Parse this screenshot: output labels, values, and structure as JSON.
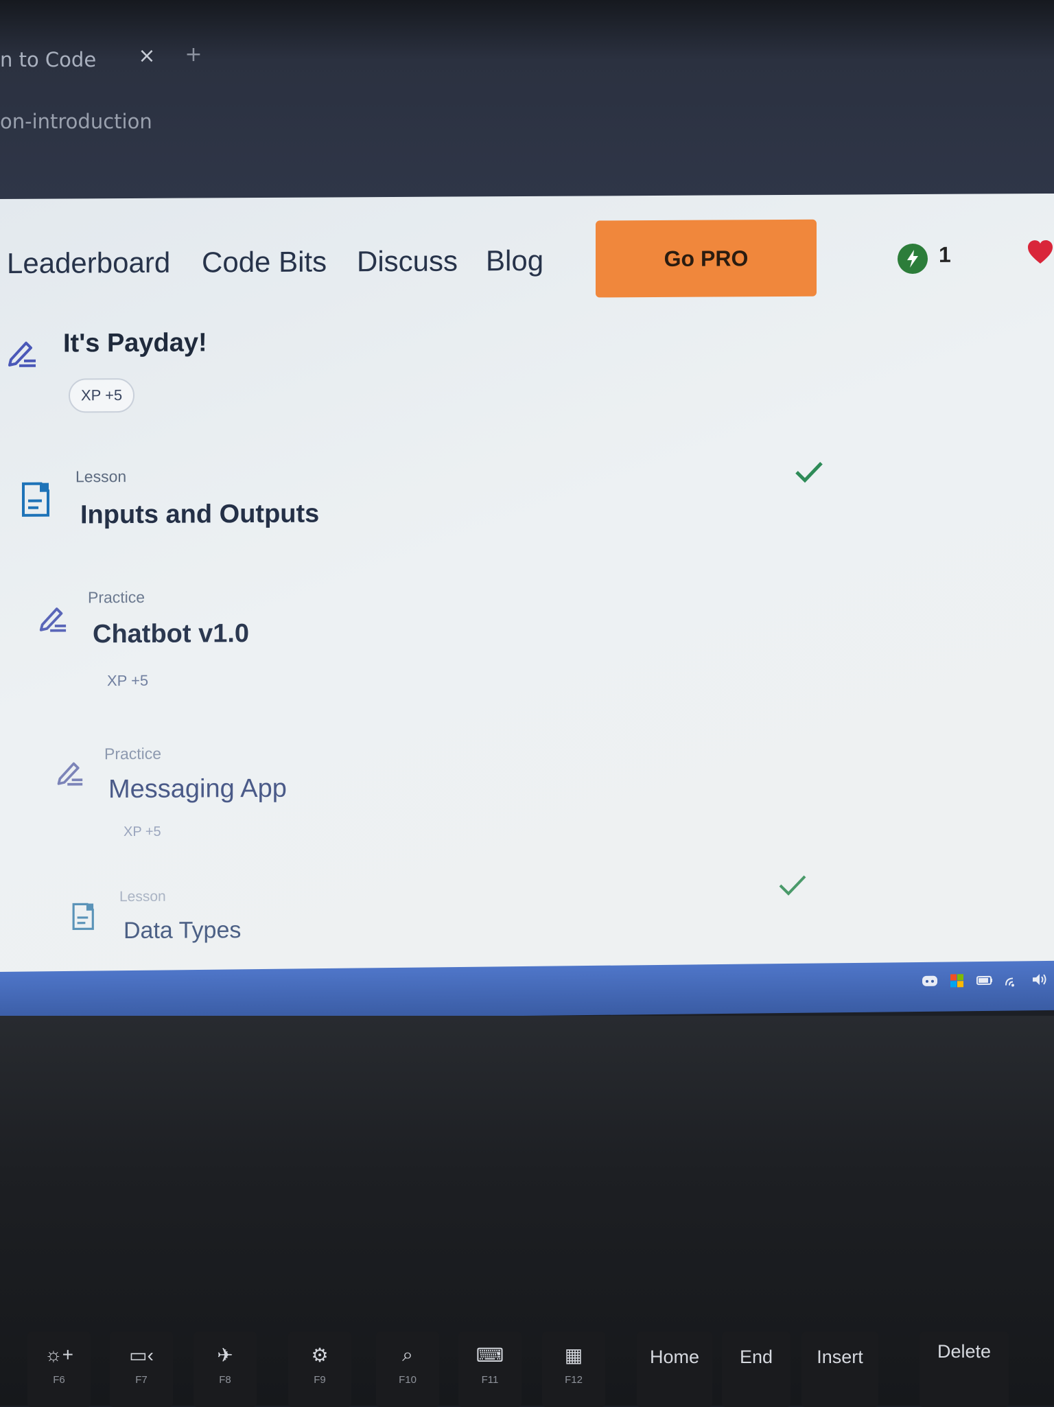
{
  "browser": {
    "tab_title": "n to Code",
    "tab_close": "×",
    "tab_new": "+",
    "url": "on-introduction"
  },
  "nav": {
    "links": [
      "Leaderboard",
      "Code Bits",
      "Discuss",
      "Blog"
    ],
    "go_pro": "Go PRO",
    "streak_count": "1"
  },
  "items": [
    {
      "type": "",
      "title": "It's Payday!",
      "xp": "XP +5",
      "icon": "practice-edit-icon",
      "completed": false
    },
    {
      "type": "Lesson",
      "title": "Inputs and Outputs",
      "xp": "",
      "icon": "lesson-document-icon",
      "completed": true
    },
    {
      "type": "Practice",
      "title": "Chatbot v1.0",
      "xp": "XP +5",
      "icon": "practice-edit-icon",
      "completed": false
    },
    {
      "type": "Practice",
      "title": "Messaging App",
      "xp": "XP +5",
      "icon": "practice-edit-icon",
      "completed": false
    },
    {
      "type": "Lesson",
      "title": "Data Types",
      "xp": "",
      "icon": "lesson-document-icon",
      "completed": true
    }
  ],
  "keyboard": {
    "fn_keys": [
      {
        "fn": "F6",
        "icon": "brightness-up-icon"
      },
      {
        "fn": "F7",
        "icon": "display-switch-icon"
      },
      {
        "fn": "F8",
        "icon": "airplane-mode-icon"
      },
      {
        "fn": "F9",
        "icon": "settings-gear-icon"
      },
      {
        "fn": "F10",
        "icon": "search-icon"
      },
      {
        "fn": "F11",
        "icon": "keyboard-icon"
      },
      {
        "fn": "F12",
        "icon": "apps-grid-icon"
      }
    ],
    "named_keys": [
      "Home",
      "End",
      "Insert",
      "Delete"
    ]
  },
  "colors": {
    "go_pro_bg": "#f0873c",
    "check": "#2e8b57",
    "heart": "#d9263a",
    "streak": "#2c7d3a",
    "taskbar": "#4f76c9"
  }
}
